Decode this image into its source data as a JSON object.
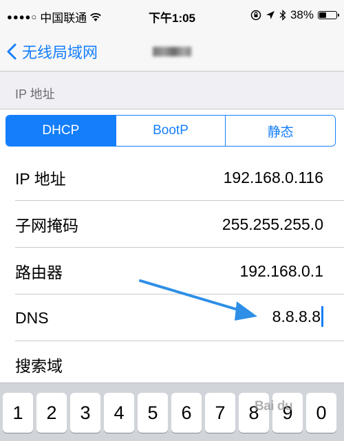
{
  "status_bar": {
    "signal": "●●●●○",
    "carrier": "中国联通",
    "time": "下午1:05",
    "battery_percent": "38%",
    "battery_level": 0.38
  },
  "nav": {
    "back_label": "无线局域网"
  },
  "section": {
    "header": "IP 地址"
  },
  "segments": [
    {
      "label": "DHCP",
      "selected": true
    },
    {
      "label": "BootP",
      "selected": false
    },
    {
      "label": "静态",
      "selected": false
    }
  ],
  "rows": [
    {
      "label": "IP 地址",
      "value": "192.168.0.116"
    },
    {
      "label": "子网掩码",
      "value": "255.255.255.0"
    },
    {
      "label": "路由器",
      "value": "192.168.0.1"
    },
    {
      "label": "DNS",
      "value": "8.8.8.8"
    },
    {
      "label": "搜索域",
      "value": ""
    }
  ],
  "keyboard": {
    "keys": [
      "1",
      "2",
      "3",
      "4",
      "5",
      "6",
      "7",
      "8",
      "9",
      "0"
    ]
  },
  "watermark": "Bai du",
  "colors": {
    "accent": "#147efb",
    "annotation_arrow": "#2e8fe6"
  }
}
